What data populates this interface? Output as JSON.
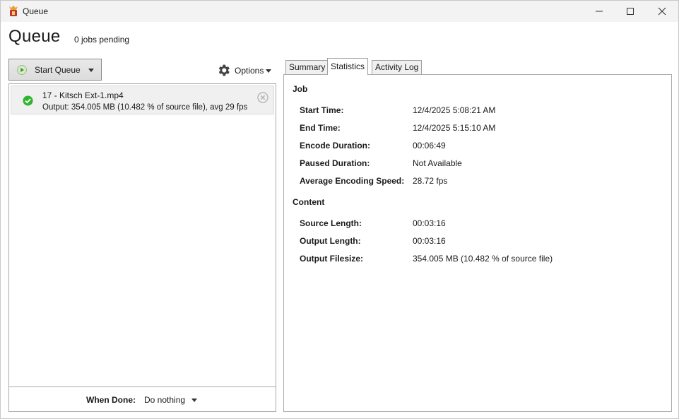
{
  "window": {
    "title": "Queue"
  },
  "header": {
    "title": "Queue",
    "pending": "0 jobs pending"
  },
  "toolbar": {
    "start_label": "Start Queue",
    "options_label": "Options"
  },
  "queue": {
    "items": [
      {
        "name": "17 - Kitsch Ext-1.mp4",
        "output": "Output: 354.005 MB (10.482 % of source file), avg 29 fps",
        "status": "completed"
      }
    ]
  },
  "when_done": {
    "label": "When Done:",
    "value": "Do nothing"
  },
  "tabs": [
    {
      "label": "Summary",
      "active": false
    },
    {
      "label": "Statistics",
      "active": true
    },
    {
      "label": "Activity Log",
      "active": false
    }
  ],
  "stats": {
    "job_title": "Job",
    "job": [
      {
        "label": "Start Time:",
        "value": "12/4/2025 5:08:21 AM"
      },
      {
        "label": "End Time:",
        "value": "12/4/2025 5:15:10 AM"
      },
      {
        "label": "Encode Duration:",
        "value": "00:06:49"
      },
      {
        "label": "Paused Duration:",
        "value": "Not Available"
      },
      {
        "label": "Average Encoding Speed:",
        "value": "28.72 fps"
      }
    ],
    "content_title": "Content",
    "content": [
      {
        "label": "Source Length:",
        "value": "00:03:16"
      },
      {
        "label": "Output Length:",
        "value": "00:03:16"
      },
      {
        "label": "Output Filesize:",
        "value": "354.005 MB (10.482 % of source file)"
      }
    ]
  },
  "colors": {
    "success": "#2fb52f",
    "play": "#4caf50"
  }
}
